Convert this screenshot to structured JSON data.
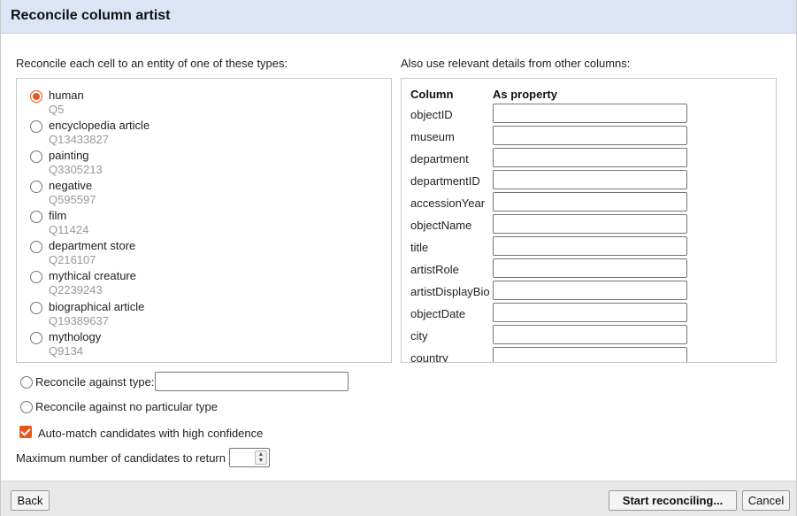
{
  "dialog": {
    "title": "Reconcile column artist",
    "types_label": "Reconcile each cell to an entity of one of these types:",
    "columns_label": "Also use relevant details from other columns:"
  },
  "types": [
    {
      "name": "human",
      "id": "Q5",
      "selected": true
    },
    {
      "name": "encyclopedia article",
      "id": "Q13433827",
      "selected": false
    },
    {
      "name": "painting",
      "id": "Q3305213",
      "selected": false
    },
    {
      "name": "negative",
      "id": "Q595597",
      "selected": false
    },
    {
      "name": "film",
      "id": "Q11424",
      "selected": false
    },
    {
      "name": "department store",
      "id": "Q216107",
      "selected": false
    },
    {
      "name": "mythical creature",
      "id": "Q2239243",
      "selected": false
    },
    {
      "name": "biographical article",
      "id": "Q19389637",
      "selected": false
    },
    {
      "name": "mythology",
      "id": "Q9134",
      "selected": false
    }
  ],
  "columns_table": {
    "header_column": "Column",
    "header_property": "As property",
    "rows": [
      {
        "name": "objectID",
        "value": ""
      },
      {
        "name": "museum",
        "value": ""
      },
      {
        "name": "department",
        "value": ""
      },
      {
        "name": "departmentID",
        "value": ""
      },
      {
        "name": "accessionYear",
        "value": ""
      },
      {
        "name": "objectName",
        "value": ""
      },
      {
        "name": "title",
        "value": ""
      },
      {
        "name": "artistRole",
        "value": ""
      },
      {
        "name": "artistDisplayBio",
        "value": ""
      },
      {
        "name": "objectDate",
        "value": ""
      },
      {
        "name": "city",
        "value": ""
      },
      {
        "name": "country",
        "value": ""
      }
    ]
  },
  "options": {
    "against_type_label": "Reconcile against type:",
    "against_type_value": "",
    "no_type_label": "Reconcile against no particular type",
    "auto_match_label": "Auto-match candidates with high confidence",
    "auto_match_checked": true,
    "max_candidates_label": "Maximum number of candidates to return",
    "max_candidates_value": ""
  },
  "footer": {
    "back_label": "Back",
    "start_label": "Start reconciling...",
    "cancel_label": "Cancel"
  },
  "colors": {
    "accent": "#e9561b",
    "title_bar": "#dbe5f5",
    "footer": "#e8e8e8",
    "type_id_text": "#999999"
  }
}
